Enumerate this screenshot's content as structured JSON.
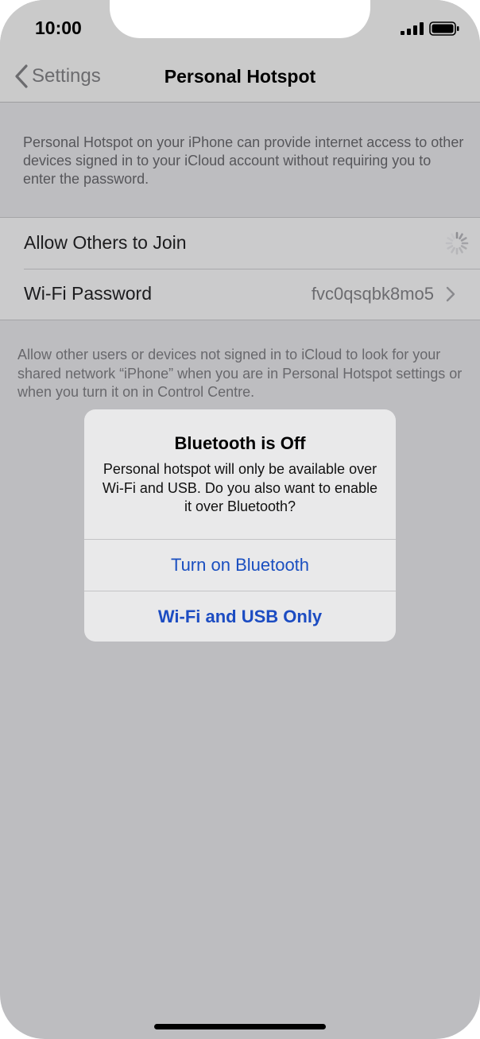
{
  "status_bar": {
    "time": "10:00"
  },
  "nav": {
    "back_label": "Settings",
    "title": "Personal Hotspot"
  },
  "header_note": "Personal Hotspot on your iPhone can provide internet access to other devices signed in to your iCloud account without requiring you to enter the password.",
  "settings": {
    "allow_others_label": "Allow Others to Join",
    "wifi_password_label": "Wi-Fi Password",
    "wifi_password_value": "fvc0qsqbk8mo5"
  },
  "footer_note": "Allow other users or devices not signed in to iCloud to look for your shared network “iPhone” when you are in Personal Hotspot settings or when you turn it on in Control Centre.",
  "alert": {
    "title": "Bluetooth is Off",
    "message": "Personal hotspot will only be available over Wi-Fi and USB. Do you also want to enable it over Bluetooth?",
    "primary_button": "Turn on Bluetooth",
    "secondary_button": "Wi-Fi and USB Only"
  },
  "icons": [
    "signal-icon",
    "battery-icon",
    "back-chevron-icon",
    "loading-spinner-icon",
    "chevron-right-icon"
  ],
  "colors": {
    "accent": "#1a4fc0",
    "dimmed_background": "#bdbdc0",
    "alert_background": "#e9e9ea"
  }
}
